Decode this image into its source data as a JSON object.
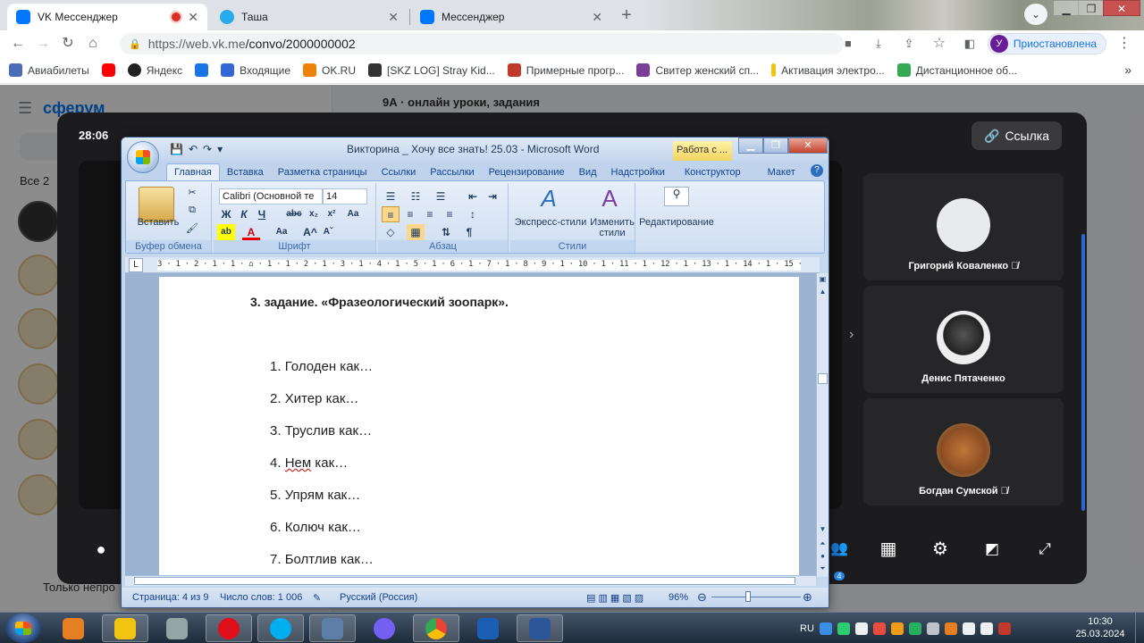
{
  "browser": {
    "tabs": [
      {
        "title": "VK Мессенджер",
        "active": true
      },
      {
        "title": "Таша",
        "active": false
      },
      {
        "title": "Мессенджер",
        "active": false
      }
    ],
    "url_host": "https://web.vk.me",
    "url_path": "/convo/2000000002",
    "profile_initial": "У",
    "profile_status": "Приостановлена",
    "bookmarks": [
      {
        "label": "Авиабилеты",
        "color": "#4b6cb7"
      },
      {
        "label": "",
        "color": "#ff0000"
      },
      {
        "label": "Яндекс",
        "color": "#222222"
      },
      {
        "label": "",
        "color": "#1a73e8"
      },
      {
        "label": "Входящие",
        "color": "#3367d6"
      },
      {
        "label": "OK.RU",
        "color": "#ee8208"
      },
      {
        "label": "[SKZ LOG] Stray Kid...",
        "color": "#333333"
      },
      {
        "label": "Примерные прогр...",
        "color": "#c0392b"
      },
      {
        "label": "Свитер женский сп...",
        "color": "#7b3f98"
      },
      {
        "label": "Активация электро...",
        "color": "#f1c40f"
      },
      {
        "label": "Дистанционное об...",
        "color": "#34a853"
      }
    ]
  },
  "vk": {
    "logo": "сферум",
    "all_label": "Все",
    "all_count": "2",
    "chat_title": "9А · онлайн уроки, задания",
    "bottom_text": "Только непро"
  },
  "call": {
    "timer": "28:06",
    "link_label": "Ссылка",
    "participants": [
      {
        "name": "Григорий Коваленко",
        "muted": true,
        "avatar_color": "#e8eaed"
      },
      {
        "name": "Денис Пятаченко",
        "muted": false,
        "avatar_color": "#ffffff"
      },
      {
        "name": "Богдан Сумской",
        "muted": true,
        "avatar_color": "#c0763a"
      }
    ],
    "people_badge": "4"
  },
  "word": {
    "title": "Викторина _ Хочу все знать! 25.03 - Microsoft Word",
    "context_tab": "Работа с ...",
    "tabs": [
      "Главная",
      "Вставка",
      "Разметка страницы",
      "Ссылки",
      "Рассылки",
      "Рецензирование",
      "Вид",
      "Надстройки",
      "Конструктор",
      "Макет"
    ],
    "ribbon": {
      "paste": "Вставить",
      "clipboard_group": "Буфер обмена",
      "font_name": "Calibri (Основной те",
      "font_size": "14",
      "font_group": "Шрифт",
      "paragraph_group": "Абзац",
      "express_styles": "Экспресс-стили",
      "change_styles": "Изменить стили",
      "styles_group": "Стили",
      "editing": "Редактирование"
    },
    "ruler": "3 · 1 · 2 · 1 · 1 · ⌂ · 1 · 1 · 2 · 1 · 3 · 1 · 4 · 1 · 5 · 1 · 6 · 1 · 7 · 1 · 8 · 9 · 1 · 10 · 1 · 11 · 1 · 12 · 1 · 13 · 1 · 14 · 1 · 15 · 1 · 16 · 1 · 17 · 1",
    "heading": "3. задание. «Фразеологический зоопарк».",
    "items": [
      {
        "num": "1.",
        "text": "Голоден как…"
      },
      {
        "num": "2.",
        "text": "Хитер как…"
      },
      {
        "num": "3.",
        "text": "Труслив как…"
      },
      {
        "num": "4.",
        "word": "Нем",
        "text": " как…"
      },
      {
        "num": "5.",
        "text": "Упрям как…"
      },
      {
        "num": "6.",
        "text": "Колюч как…"
      },
      {
        "num": "7.",
        "text": "Болтлив как…"
      }
    ],
    "status": {
      "page": "Страница: 4 из 9",
      "words": "Число слов: 1 006",
      "lang": "Русский (Россия)",
      "zoom": "96%"
    }
  },
  "taskbar": {
    "lang": "RU",
    "time": "10:30",
    "date": "25.03.2024",
    "apps": [
      {
        "name": "media-player",
        "color": "#e67e22"
      },
      {
        "name": "explorer",
        "color": "#f1c40f"
      },
      {
        "name": "calculator",
        "color": "#95a5a6"
      },
      {
        "name": "opera",
        "color": "#e0101b"
      },
      {
        "name": "skype",
        "color": "#00aff0"
      },
      {
        "name": "monitor",
        "color": "#5d7ea6"
      },
      {
        "name": "viber",
        "color": "#7360f2"
      },
      {
        "name": "chrome",
        "color": "#34a853"
      },
      {
        "name": "shield",
        "color": "#1a5fb4"
      },
      {
        "name": "word",
        "color": "#2b579a"
      }
    ]
  }
}
